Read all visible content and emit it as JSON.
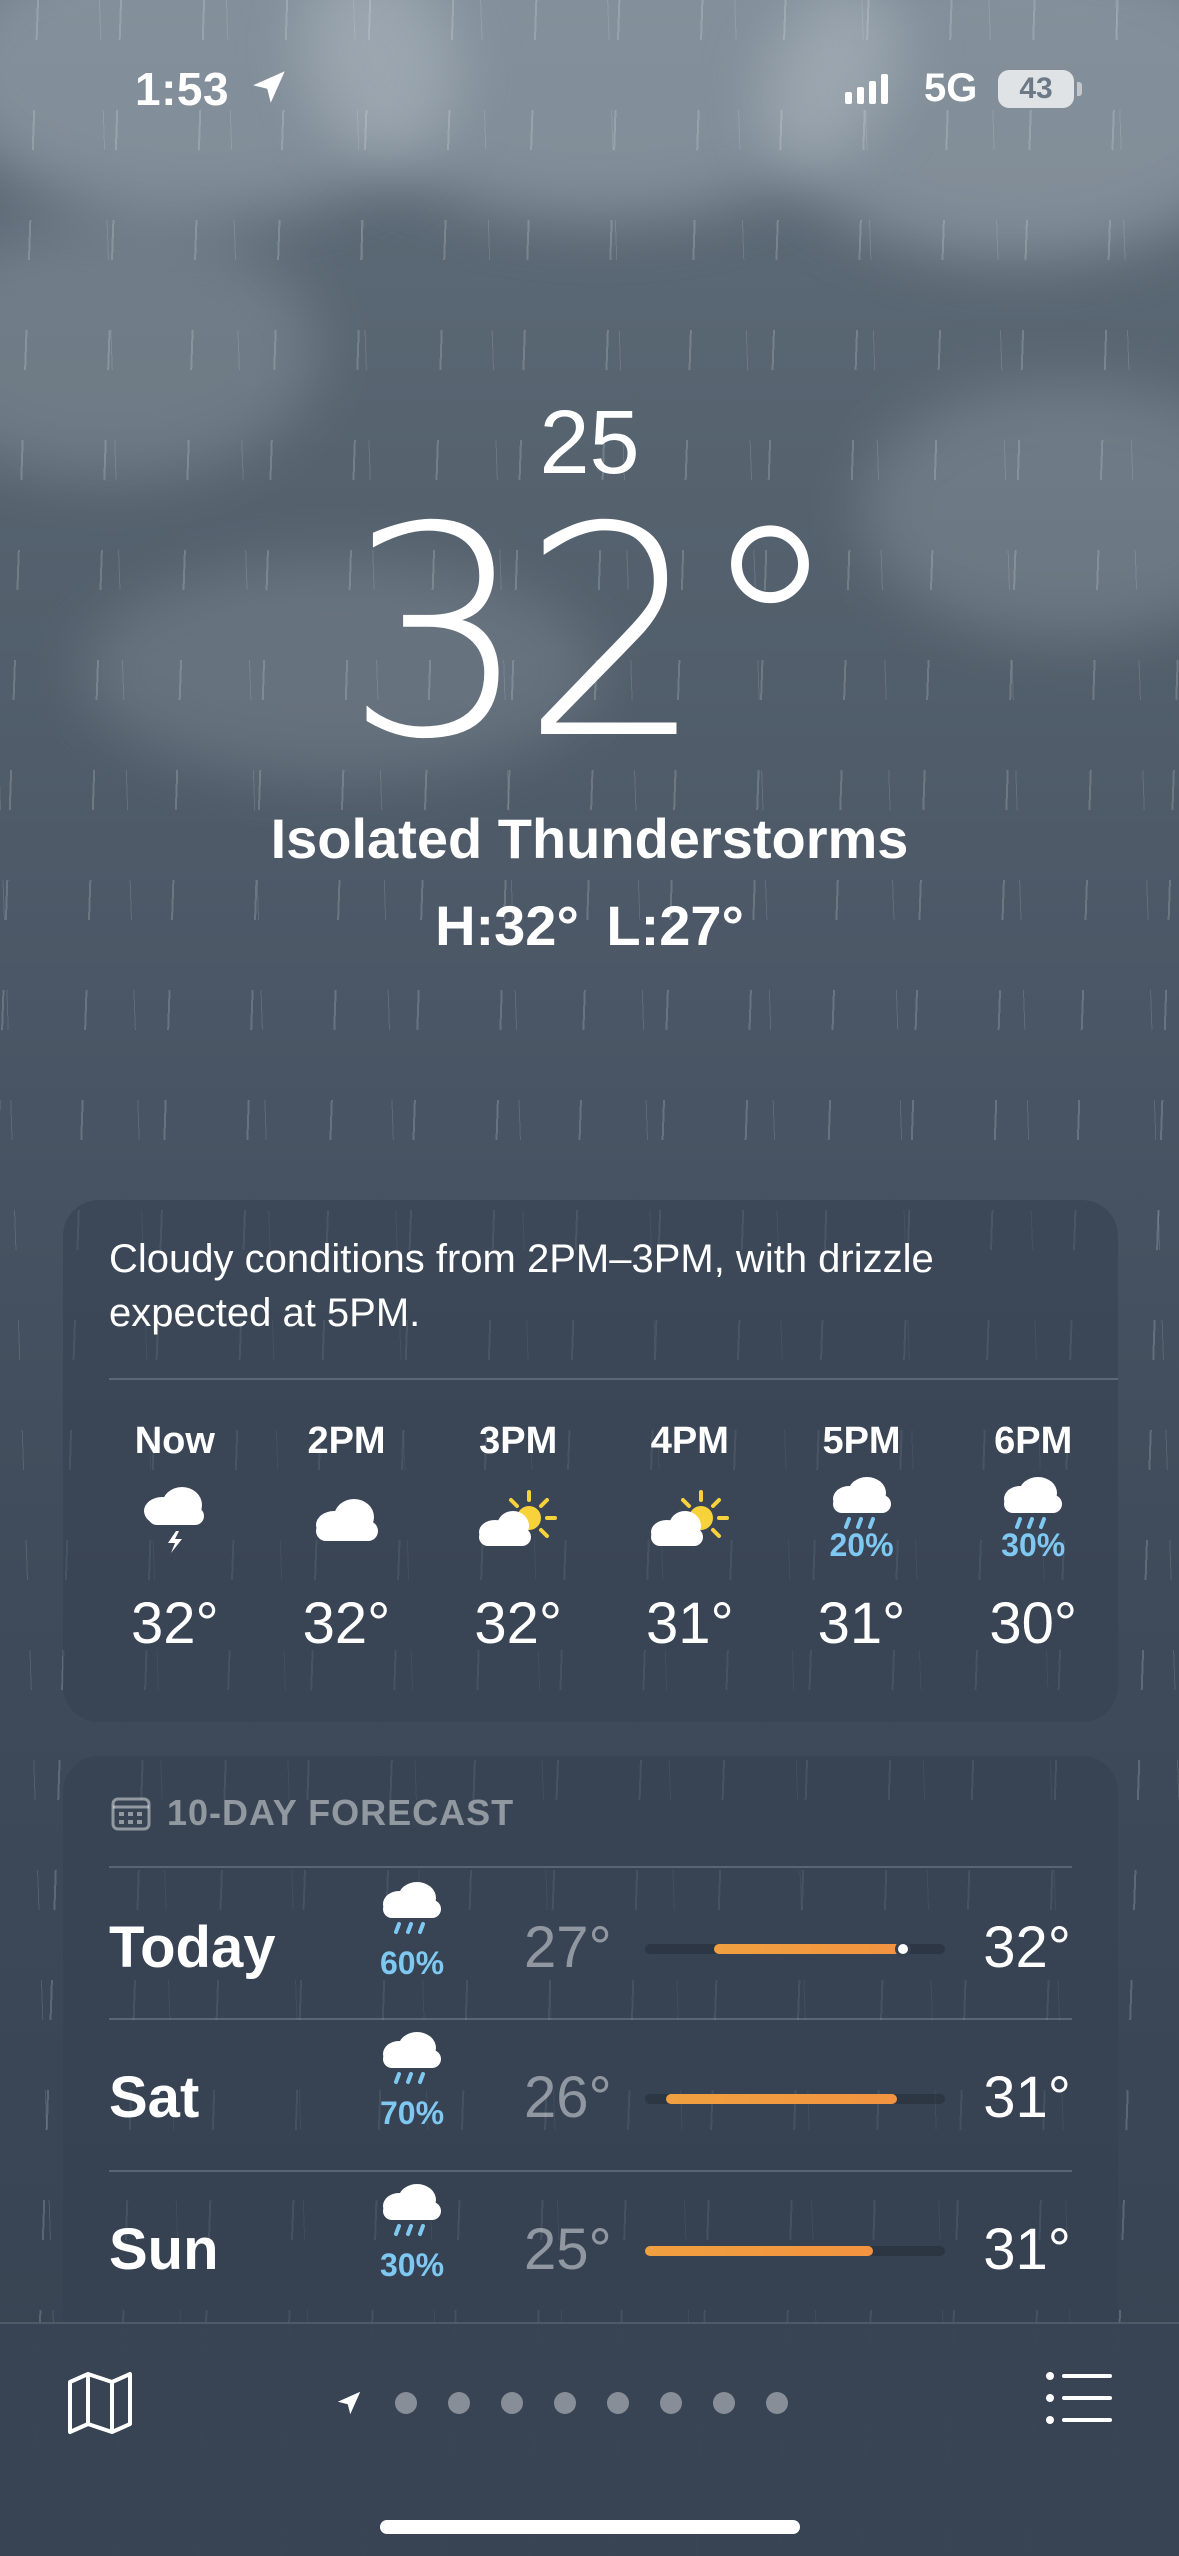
{
  "status_bar": {
    "time": "1:53",
    "network": "5G",
    "battery": "43"
  },
  "header": {
    "location": "25",
    "temperature": "32°",
    "condition": "Isolated Thunderstorms",
    "hilo": "H:32°  L:27°"
  },
  "hourly": {
    "summary": "Cloudy conditions from 2PM–3PM, with drizzle expected at 5PM.",
    "items": [
      {
        "label": "Now",
        "icon": "thunderstorm-icon",
        "pct": "",
        "temp": "32°"
      },
      {
        "label": "2PM",
        "icon": "cloud-icon",
        "pct": "",
        "temp": "32°"
      },
      {
        "label": "3PM",
        "icon": "partly-sunny-icon",
        "pct": "",
        "temp": "32°"
      },
      {
        "label": "4PM",
        "icon": "partly-sunny-icon",
        "pct": "",
        "temp": "31°"
      },
      {
        "label": "5PM",
        "icon": "rain-icon",
        "pct": "20%",
        "temp": "31°"
      },
      {
        "label": "6PM",
        "icon": "rain-icon",
        "pct": "30%",
        "temp": "30°"
      }
    ]
  },
  "forecast": {
    "title": "10-DAY FORECAST",
    "days": [
      {
        "day": "Today",
        "icon": "rain-icon",
        "pct": "60%",
        "low": "27°",
        "high": "32°",
        "range_start": 0.23,
        "range_end": 0.86,
        "current": 0.86
      },
      {
        "day": "Sat",
        "icon": "rain-icon",
        "pct": "70%",
        "low": "26°",
        "high": "31°",
        "range_start": 0.07,
        "range_end": 0.84
      },
      {
        "day": "Sun",
        "icon": "rain-icon",
        "pct": "30%",
        "low": "25°",
        "high": "31°",
        "range_start": 0.0,
        "range_end": 0.76
      }
    ]
  },
  "bottom_bar": {
    "page_count": 9
  },
  "colors": {
    "precip_blue": "#7ec8f2",
    "range_orange": "#f39340",
    "sun_yellow": "#f7d23a"
  }
}
